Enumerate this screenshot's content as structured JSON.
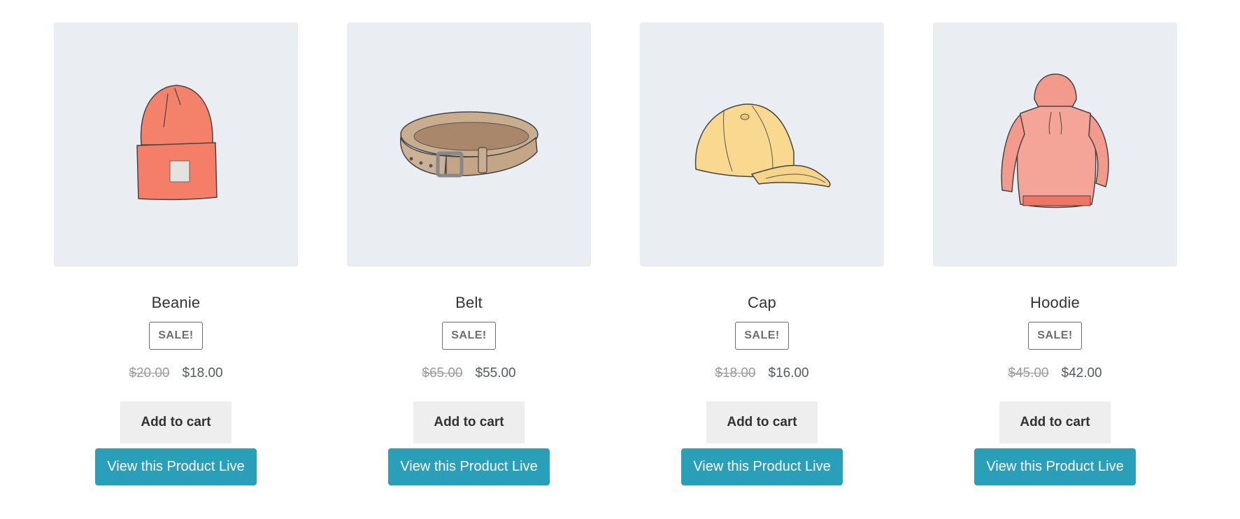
{
  "colors": {
    "image_bg": "#eaeef2",
    "cart_button_bg": "#eeeeee",
    "live_button_bg": "#2a9fb9",
    "sale_badge_border": "#6d6d6d",
    "old_price": "#9a9a9a"
  },
  "products": [
    {
      "name": "Beanie",
      "image_icon": "beanie-image",
      "sale_badge": "SALE!",
      "old_price": "$20.00",
      "new_price": "$18.00",
      "cart_label": "Add to cart",
      "live_label": "View this Product Live"
    },
    {
      "name": "Belt",
      "image_icon": "belt-image",
      "sale_badge": "SALE!",
      "old_price": "$65.00",
      "new_price": "$55.00",
      "cart_label": "Add to cart",
      "live_label": "View this Product Live"
    },
    {
      "name": "Cap",
      "image_icon": "cap-image",
      "sale_badge": "SALE!",
      "old_price": "$18.00",
      "new_price": "$16.00",
      "cart_label": "Add to cart",
      "live_label": "View this Product Live"
    },
    {
      "name": "Hoodie",
      "image_icon": "hoodie-image",
      "sale_badge": "SALE!",
      "old_price": "$45.00",
      "new_price": "$42.00",
      "cart_label": "Add to cart",
      "live_label": "View this Product Live"
    }
  ]
}
